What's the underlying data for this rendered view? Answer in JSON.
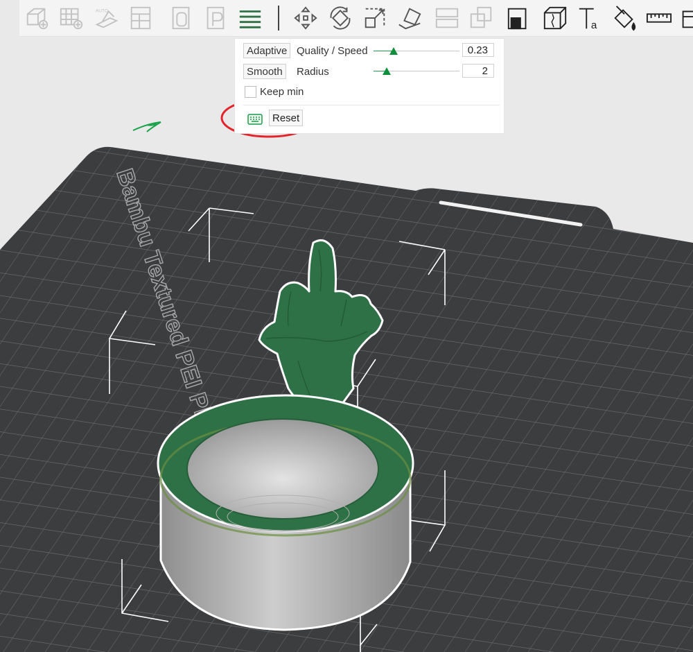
{
  "toolbar": {
    "tools": [
      {
        "icon": "add-cube-icon"
      },
      {
        "icon": "add-grid-icon"
      },
      {
        "icon": "auto-orient-icon"
      },
      {
        "icon": "arrange-icon"
      },
      {
        "icon": "plate-zero-icon"
      },
      {
        "icon": "plate-p-icon"
      },
      {
        "icon": "variable-layer-height-icon",
        "active": true
      },
      {
        "icon": "move-icon"
      },
      {
        "icon": "rotate-icon"
      },
      {
        "icon": "scale-icon"
      },
      {
        "icon": "lay-on-face-icon"
      },
      {
        "icon": "split-icon"
      },
      {
        "icon": "mesh-boolean-icon"
      },
      {
        "icon": "cut-icon"
      },
      {
        "icon": "support-paint-icon"
      },
      {
        "icon": "text-icon"
      },
      {
        "icon": "color-paint-icon"
      },
      {
        "icon": "measure-icon"
      },
      {
        "icon": "assembly-icon"
      }
    ]
  },
  "layer_panel": {
    "adaptive_label": "Adaptive",
    "quality_speed_label": "Quality / Speed",
    "quality_value": "0.23",
    "quality_fraction": 0.23,
    "smooth_label": "Smooth",
    "radius_label": "Radius",
    "radius_value": "2",
    "radius_fraction": 0.15,
    "keep_min_label": "Keep min",
    "keep_min_checked": false,
    "keyboard_icon": "keyboard-icon",
    "reset_label": "Reset"
  },
  "scene": {
    "plate_label": "Bambu Textured PEI Plate",
    "model_color": "#2f7146",
    "body_color": "#b9b9b9",
    "plate_color": "#3c3d3f",
    "annotation_color": "#e3242b"
  }
}
